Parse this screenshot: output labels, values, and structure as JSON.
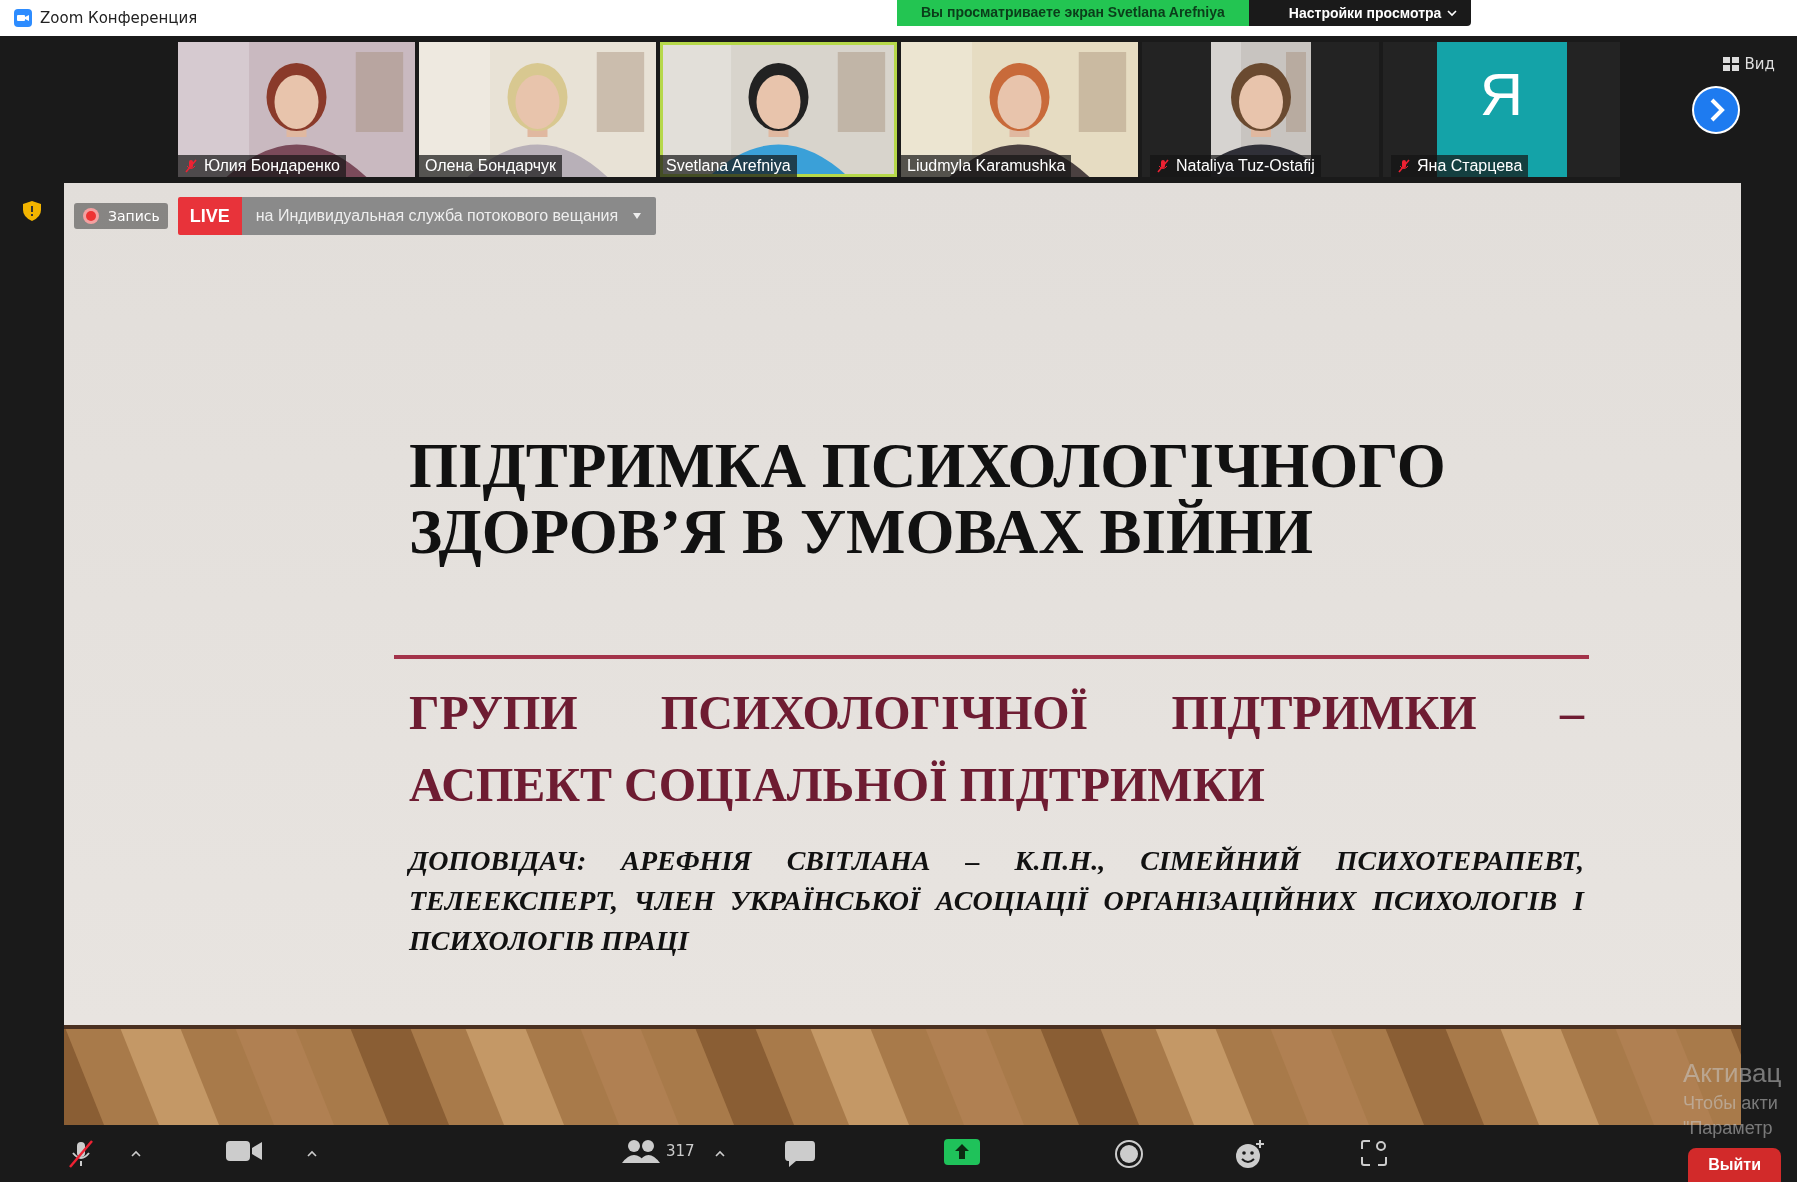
{
  "window": {
    "title": "Zoom Конференция"
  },
  "share_banner": {
    "text": "Вы просматриваете экран Svetlana Arefniya",
    "view_options": "Настройки просмотра"
  },
  "participants": [
    {
      "name": "Юлия Бондаренко",
      "muted": true,
      "speaking": false,
      "kind": "video"
    },
    {
      "name": "Олена Бондарчук",
      "muted": false,
      "speaking": false,
      "kind": "video"
    },
    {
      "name": "Svetlana Arefniya",
      "muted": false,
      "speaking": true,
      "kind": "video"
    },
    {
      "name": "Liudmyla Karamushka",
      "muted": false,
      "speaking": false,
      "kind": "video"
    },
    {
      "name": "Nataliya Tuz-Ostafij",
      "muted": true,
      "speaking": false,
      "kind": "portrait"
    },
    {
      "name": "Яна Старцева",
      "muted": true,
      "speaking": false,
      "kind": "avatar",
      "initial": "Я"
    }
  ],
  "view_button": "Вид",
  "recording": {
    "label": "Запись"
  },
  "live": {
    "badge": "LIVE",
    "service": "на Индивидуальная служба потокового вещания"
  },
  "slide": {
    "title_lines": [
      "ПІДТРИМКА ПСИХОЛОГІЧНОГО",
      "ЗДОРОВ’Я В УМОВАХ ВІЙНИ"
    ],
    "subtitle": "ГРУПИ ПСИХОЛОГІЧНОЇ ПІДТРИМКИ – АСПЕКТ СОЦІАЛЬНОЇ ПІДТРИМКИ",
    "speaker": "ДОПОВІДАЧ: АРЕФНІЯ СВІТЛАНА – К.П.Н., СІМЕЙНИЙ ПСИХОТЕРАПЕВТ, ТЕЛЕЕКСПЕРТ, ЧЛЕН УКРАЇНСЬКОЇ АСОЦІАЦІЇ ОРГАНІЗАЦІЙНИХ ПСИХОЛОГІВ І ПСИХОЛОГІВ ПРАЦІ"
  },
  "toolbar": {
    "mic_muted": true,
    "participant_count": "317",
    "leave": "Выйти"
  },
  "activation_notice": [
    "Активац",
    "Чтобы акти",
    "\"Параметр"
  ]
}
